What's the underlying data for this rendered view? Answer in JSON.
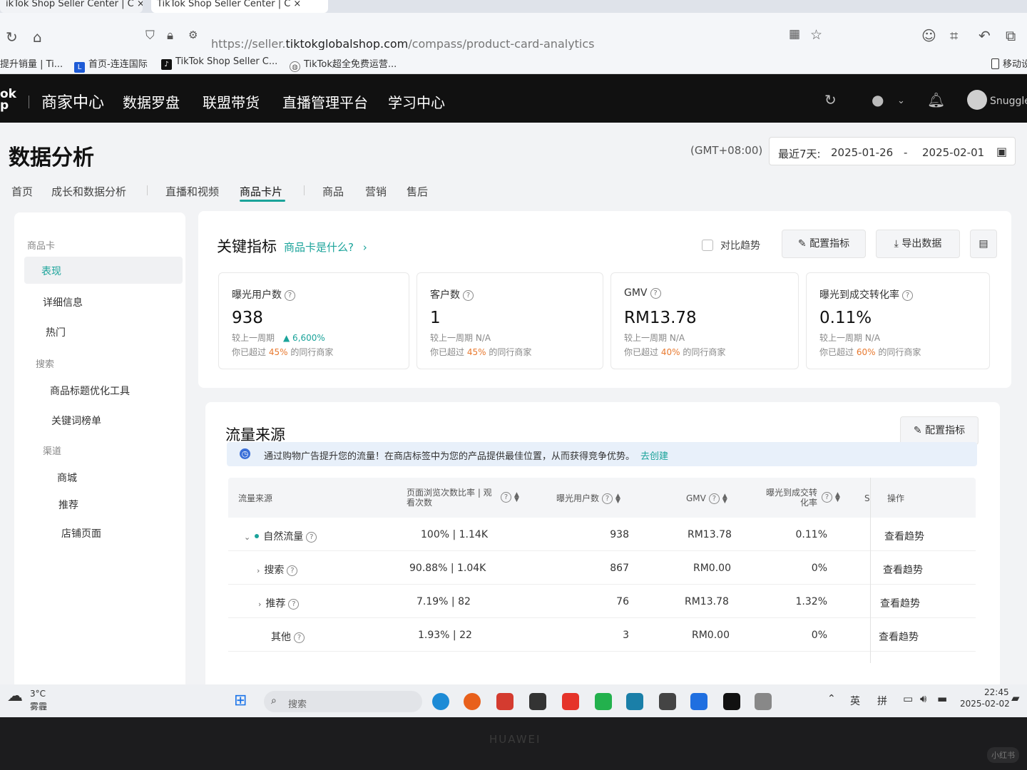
{
  "browser": {
    "tabs": [
      {
        "label": "ikTok Shop Seller Center | C ×"
      },
      {
        "label": "TikTok Shop Seller Center | C ×"
      }
    ],
    "url_prefix": "https://seller.",
    "url_domain": "tiktokglobalshop.com",
    "url_path": "/compass/product-card-analytics",
    "bookmarks": [
      {
        "label": "提升销量 | Ti..."
      },
      {
        "label": "首页-连连国际"
      },
      {
        "label": "TikTok Shop Seller C..."
      },
      {
        "label": "TikTok超全免费运营..."
      },
      {
        "label": "移动设"
      }
    ]
  },
  "appbar": {
    "logo": "ok\np",
    "brand": "商家中心",
    "nav": [
      "数据罗盘",
      "联盟带货",
      "直播管理平台",
      "学习中心"
    ],
    "username": "Snuggle"
  },
  "page": {
    "title": "数据分析",
    "timezone": "(GMT+08:00)",
    "date_preset": "最近7天:",
    "date_start": "2025-01-26",
    "date_sep": "-",
    "date_end": "2025-02-01",
    "subnav": [
      "首页",
      "成长和数据分析",
      "直播和视频",
      "商品卡片",
      "商品",
      "营销",
      "售后"
    ]
  },
  "sidebar": {
    "groups": [
      {
        "label": "商品卡",
        "items": [
          "表现",
          "详细信息",
          "热门"
        ]
      },
      {
        "label": "搜索",
        "items": [
          "商品标题优化工具",
          "关键词榜单"
        ]
      },
      {
        "label": "渠道",
        "items": [
          "商城",
          "推荐",
          "店铺页面"
        ]
      }
    ],
    "active_item": "表现"
  },
  "key_metrics": {
    "title": "关键指标",
    "help_link": "商品卡是什么?",
    "compare_label": "对比趋势",
    "config_button": "配置指标",
    "export_button": "导出数据",
    "metrics": [
      {
        "label": "曝光用户数",
        "value": "938",
        "cmp_label": "较上一周期",
        "cmp_value": "▲ 6,600%",
        "beat_prefix": "你已超过",
        "beat_pct": "45%",
        "beat_suffix": "的同行商家"
      },
      {
        "label": "客户数",
        "value": "1",
        "cmp_label": "较上一周期",
        "cmp_value": "N/A",
        "beat_prefix": "你已超过",
        "beat_pct": "45%",
        "beat_suffix": "的同行商家"
      },
      {
        "label": "GMV",
        "value": "RM13.78",
        "cmp_label": "较上一周期",
        "cmp_value": "N/A",
        "beat_prefix": "你已超过",
        "beat_pct": "40%",
        "beat_suffix": "的同行商家"
      },
      {
        "label": "曝光到成交转化率",
        "value": "0.11%",
        "cmp_label": "较上一周期",
        "cmp_value": "N/A",
        "beat_prefix": "你已超过",
        "beat_pct": "60%",
        "beat_suffix": "的同行商家"
      }
    ]
  },
  "traffic": {
    "title": "流量来源",
    "config_button": "配置指标",
    "banner_text": "通过购物广告提升您的流量！在商店标签中为您的产品提供最佳位置，从而获得竞争优势。",
    "banner_link": "去创建",
    "columns": [
      "流量来源",
      "页面浏览次数比率 | 观看次数",
      "曝光用户数",
      "GMV",
      "曝光到成交转化率",
      "S",
      "操作"
    ],
    "rows": [
      {
        "source": "自然流量",
        "ratio": "100% | 1.14K",
        "exposure": "938",
        "gmv": "RM13.78",
        "rate": "0.11%",
        "action": "查看趋势"
      },
      {
        "source": "搜索",
        "ratio": "90.88% | 1.04K",
        "exposure": "867",
        "gmv": "RM0.00",
        "rate": "0%",
        "action": "查看趋势"
      },
      {
        "source": "推荐",
        "ratio": "7.19% | 82",
        "exposure": "76",
        "gmv": "RM13.78",
        "rate": "1.32%",
        "action": "查看趋势"
      },
      {
        "source": "其他",
        "ratio": "1.93% | 22",
        "exposure": "3",
        "gmv": "RM0.00",
        "rate": "0%",
        "action": "查看趋势"
      }
    ]
  },
  "taskbar": {
    "weather_temp": "3°C",
    "weather_desc": "雾霾",
    "search_placeholder": "搜索",
    "ime_1": "英",
    "ime_2": "拼",
    "time": "22:45",
    "date": "2025-02-02"
  },
  "device": {
    "brand": "HUAWEI",
    "watermark": "小红书"
  }
}
